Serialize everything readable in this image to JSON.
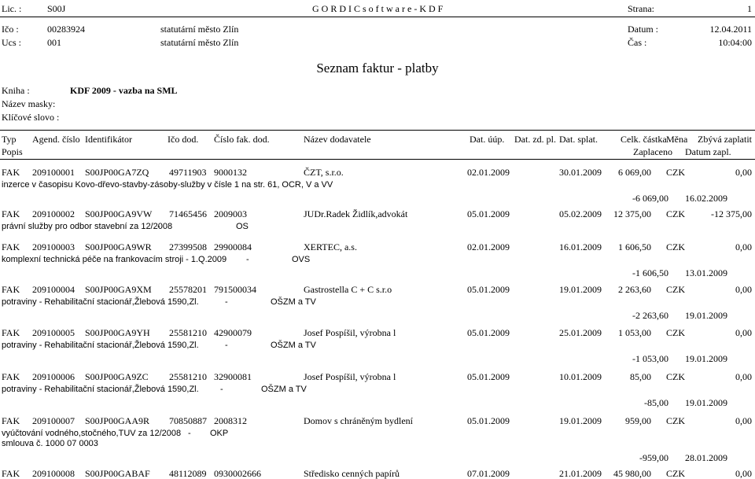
{
  "header": {
    "lic_label": "Lic. :",
    "lic_value": "S00J",
    "company": "G O R D I C  s o f t w a r e - K D F",
    "strana_label": "Strana:",
    "strana_value": "1",
    "ico_label": "Ičo :",
    "ico_value": "00283924",
    "ico_org": "statutární město Zlín",
    "datum_label": "Datum :",
    "datum_value": "12.04.2011",
    "ucs_label": "Ucs :",
    "ucs_value": "001",
    "ucs_org": "statutární město Zlín",
    "cas_label": "Čas :",
    "cas_value": "10:04:00"
  },
  "report_title": "Seznam faktur - platby",
  "filters": {
    "kniha_label": "Kniha :",
    "kniha_value": "KDF 2009 - vazba na SML",
    "maska_label": "Název masky:",
    "slova_label": "Klíčové slovo :"
  },
  "columns": {
    "typ": "Typ",
    "agend": "Agend. číslo",
    "ident": "Identifikátor",
    "ico": "Ičo dod.",
    "cislo": "Číslo fak. dod.",
    "nazev": "Název dodavatele",
    "dat_uup": "Dat. úúp.",
    "dat_zdpl": "Dat. zd. pl.",
    "dat_splat": "Dat. splat.",
    "celk": "Celk. částka",
    "mena": "Měna",
    "zbyva": "Zbývá zaplatit",
    "popis": "Popis",
    "zaplaceno": "Zaplaceno",
    "datum_zapl": "Datum zapl."
  },
  "rows": [
    {
      "typ": "FAK",
      "agend": "209100001",
      "ident": "S00JP00GA7ZQ",
      "ico": "49711903",
      "cislo": "9000132",
      "nazev": "ČZT, s.r.o.",
      "dat_uup": "02.01.2009",
      "dat_zdpl": "",
      "dat_splat": "30.01.2009",
      "castka": "6 069,00",
      "mena": "CZK",
      "zbyva": "0,00",
      "popis": [
        "inzerce v časopisu Kovo-dřevo-stavby-zásoby-služby v čísle 1 na str. 61, OCR, V  a VV"
      ],
      "zaplaceno": "-6 069,00",
      "datum_zapl": "16.02.2009"
    },
    {
      "typ": "FAK",
      "agend": "209100002",
      "ident": "S00JP00GA9VW",
      "ico": "71465456",
      "cislo": "2009003",
      "nazev": "JUDr.Radek Židlík,advokát",
      "dat_uup": "05.01.2009",
      "dat_zdpl": "",
      "dat_splat": "05.02.2009",
      "castka": "12 375,00",
      "mena": "CZK",
      "zbyva": "-12 375,00",
      "popis": [
        "právní služby pro odbor stavební za 12/2008",
        "-",
        "OS"
      ],
      "zaplaceno": "",
      "datum_zapl": ""
    },
    {
      "typ": "FAK",
      "agend": "209100003",
      "ident": "S00JP00GA9WR",
      "ico": "27399508",
      "cislo": "29900084",
      "nazev": "XERTEC, a.s.",
      "dat_uup": "02.01.2009",
      "dat_zdpl": "",
      "dat_splat": "16.01.2009",
      "castka": "1 606,50",
      "mena": "CZK",
      "zbyva": "0,00",
      "popis": [
        "komplexní technická péče na frankovacím stroji - 1.Q.2009",
        "-",
        "OVS"
      ],
      "zaplaceno": "-1 606,50",
      "datum_zapl": "13.01.2009"
    },
    {
      "typ": "FAK",
      "agend": "209100004",
      "ident": "S00JP00GA9XM",
      "ico": "25578201",
      "cislo": "791500034",
      "nazev": "Gastrostella C + C s.r.o",
      "dat_uup": "05.01.2009",
      "dat_zdpl": "",
      "dat_splat": "19.01.2009",
      "castka": "2 263,60",
      "mena": "CZK",
      "zbyva": "0,00",
      "popis": [
        "potraviny - Rehabilitační stacionář,Žlebová 1590,Zl.",
        "-",
        "OŠZM  a TV"
      ],
      "zaplaceno": "-2 263,60",
      "datum_zapl": "19.01.2009"
    },
    {
      "typ": "FAK",
      "agend": "209100005",
      "ident": "S00JP00GA9YH",
      "ico": "25581210",
      "cislo": "42900079",
      "nazev": "Josef Pospíšil, výrobna l",
      "dat_uup": "05.01.2009",
      "dat_zdpl": "",
      "dat_splat": "25.01.2009",
      "castka": "1 053,00",
      "mena": "CZK",
      "zbyva": "0,00",
      "popis": [
        "potraviny - Rehabilitační stacionář,Žlebová 1590,Zl.",
        "-",
        "OŠZM  a  TV"
      ],
      "zaplaceno": "-1 053,00",
      "datum_zapl": "19.01.2009"
    },
    {
      "typ": "FAK",
      "agend": "209100006",
      "ident": "S00JP00GA9ZC",
      "ico": "25581210",
      "cislo": "32900081",
      "nazev": "Josef Pospíšil, výrobna l",
      "dat_uup": "05.01.2009",
      "dat_zdpl": "",
      "dat_splat": "10.01.2009",
      "castka": "85,00",
      "mena": "CZK",
      "zbyva": "0,00",
      "popis": [
        "potraviny - Rehabilitační stacionář,Žlebová 1590,Zl.",
        "-",
        "OŠZM  a TV"
      ],
      "zaplaceno": "-85,00",
      "datum_zapl": "19.01.2009"
    },
    {
      "typ": "FAK",
      "agend": "209100007",
      "ident": "S00JP00GAA9R",
      "ico": "70850887",
      "cislo": "2008312",
      "nazev": "Domov s chráněným bydlení",
      "dat_uup": "05.01.2009",
      "dat_zdpl": "",
      "dat_splat": "19.01.2009",
      "castka": "959,00",
      "mena": "CZK",
      "zbyva": "0,00",
      "popis": [
        "vyúčtování vodného,stočného,TUV za 12/2008",
        "-",
        "OKP"
      ],
      "popis_line2": "smlouva č. 1000 07 0003",
      "zaplaceno": "-959,00",
      "datum_zapl": "28.01.2009"
    },
    {
      "typ": "FAK",
      "agend": "209100008",
      "ident": "S00JP00GABAF",
      "ico": "48112089",
      "cislo": "0930002666",
      "nazev": "Středisko cenných papírů",
      "dat_uup": "07.01.2009",
      "dat_zdpl": "",
      "dat_splat": "21.01.2009",
      "castka": "45 980,00",
      "mena": "CZK",
      "zbyva": "0,00",
      "popis": [],
      "zaplaceno": "",
      "datum_zapl": ""
    }
  ]
}
